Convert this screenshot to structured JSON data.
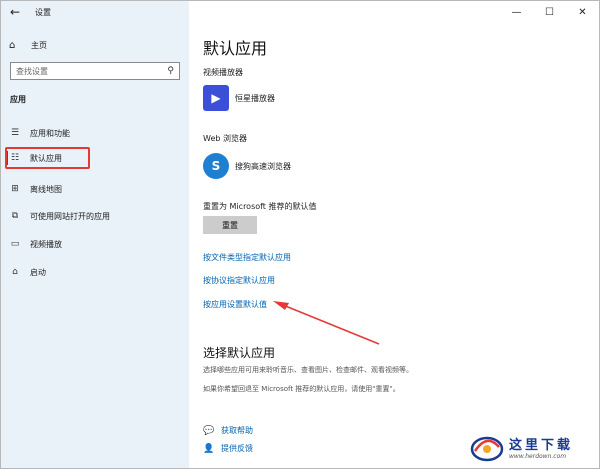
{
  "app": {
    "title": "设置",
    "back_icon": "back-arrow-icon"
  },
  "window_controls": {
    "minimize": "—",
    "maximize": "☐",
    "close": "✕"
  },
  "sidebar": {
    "home_label": "主页",
    "search_placeholder": "查找设置",
    "section_label": "应用",
    "items": [
      {
        "label": "应用和功能",
        "icon": "apps-list-icon",
        "glyph": "☰"
      },
      {
        "label": "默认应用",
        "icon": "default-apps-icon",
        "glyph": "☷",
        "active": true
      },
      {
        "label": "离线地图",
        "icon": "offline-map-icon",
        "glyph": "⊞"
      },
      {
        "label": "可使用网站打开的应用",
        "icon": "website-apps-icon",
        "glyph": "⧉"
      },
      {
        "label": "视频播放",
        "icon": "video-playback-icon",
        "glyph": "▭"
      },
      {
        "label": "启动",
        "icon": "startup-icon",
        "glyph": "⌂"
      }
    ]
  },
  "main": {
    "title": "默认应用",
    "video_group": {
      "label": "视频播放器",
      "app_name": "恒星播放器",
      "icon_color": "#3b4fd8"
    },
    "browser_group": {
      "label": "Web 浏览器",
      "app_name": "搜狗高速浏览器",
      "icon_color": "#1f7fd0"
    },
    "reset": {
      "label": "重置为 Microsoft 推荐的默认值",
      "button": "重置"
    },
    "links": [
      "按文件类型指定默认应用",
      "按协议指定默认应用",
      "按应用设置默认值"
    ],
    "choose": {
      "title": "选择默认应用",
      "desc1": "选择哪些应用可用来聆听音乐、查看图片、检查邮件、观看视频等。",
      "desc2": "如果你希望回退至 Microsoft 推荐的默认应用，请使用\"重置\"。"
    },
    "help": {
      "get_help": "获取帮助",
      "feedback": "提供反馈"
    }
  },
  "annotation": {
    "highlight_color": "#e53935"
  },
  "watermark": {
    "cn": "这里下载",
    "url": "www.herdown.com"
  }
}
